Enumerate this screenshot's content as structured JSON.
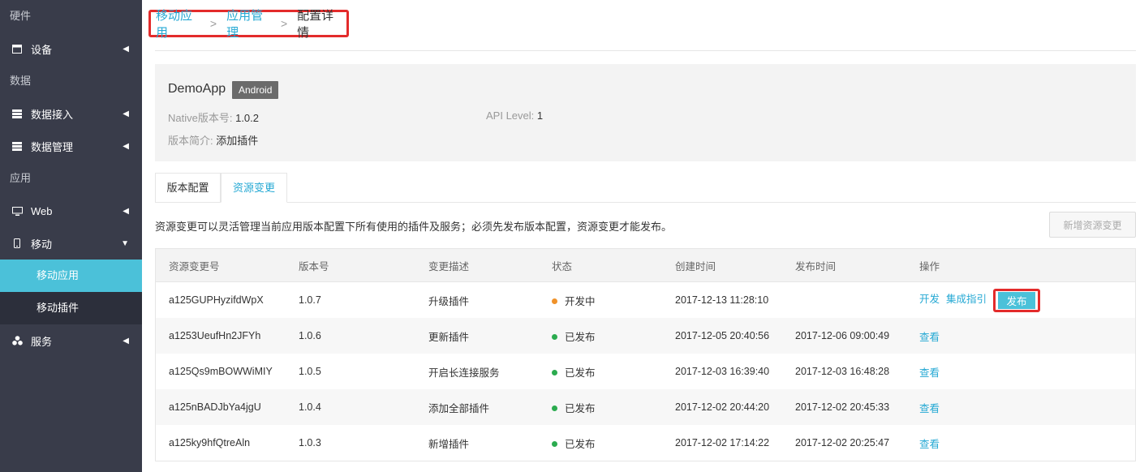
{
  "sidebar": {
    "group_hardware": "硬件",
    "item_device": "设备",
    "group_data": "数据",
    "item_data_ingest": "数据接入",
    "item_data_manage": "数据管理",
    "group_app": "应用",
    "item_web": "Web",
    "item_mobile": "移动",
    "sub_mobile_app": "移动应用",
    "sub_mobile_plugin": "移动插件",
    "item_service": "服务"
  },
  "breadcrumb": {
    "level1": "移动应用",
    "level2": "应用管理",
    "current": "配置详情",
    "separator": ">"
  },
  "app_info": {
    "name": "DemoApp",
    "platform_tag": "Android",
    "native_version_label": "Native版本号:",
    "native_version_value": "1.0.2",
    "api_level_label": "API Level:",
    "api_level_value": "1",
    "version_desc_label": "版本简介:",
    "version_desc_value": "添加插件"
  },
  "tabs": {
    "version_config": "版本配置",
    "resource_change": "资源变更",
    "active": "资源变更"
  },
  "description": "资源变更可以灵活管理当前应用版本配置下所有使用的插件及服务；必须先发布版本配置，资源变更才能发布。",
  "new_button": "新增资源变更",
  "table": {
    "headers": [
      "资源变更号",
      "版本号",
      "变更描述",
      "状态",
      "创建时间",
      "发布时间",
      "操作"
    ],
    "rows": [
      {
        "id": "a125GUPHyzifdWpX",
        "version": "1.0.7",
        "desc": "升级插件",
        "status": "开发中",
        "created": "2017-12-13 11:28:10",
        "published": "",
        "actions": [
          "开发",
          "集成指引"
        ],
        "publish_button": "发布"
      },
      {
        "id": "a1253UeufHn2JFYh",
        "version": "1.0.6",
        "desc": "更新插件",
        "status": "已发布",
        "created": "2017-12-05 20:40:56",
        "published": "2017-12-06 09:00:49",
        "actions": [
          "查看"
        ]
      },
      {
        "id": "a125Qs9mBOWWiMIY",
        "version": "1.0.5",
        "desc": "开启长连接服务",
        "status": "已发布",
        "created": "2017-12-03 16:39:40",
        "published": "2017-12-03 16:48:28",
        "actions": [
          "查看"
        ]
      },
      {
        "id": "a125nBADJbYa4jgU",
        "version": "1.0.4",
        "desc": "添加全部插件",
        "status": "已发布",
        "created": "2017-12-02 20:44:20",
        "published": "2017-12-02 20:45:33",
        "actions": [
          "查看"
        ]
      },
      {
        "id": "a125ky9hfQtreAln",
        "version": "1.0.3",
        "desc": "新增插件",
        "status": "已发布",
        "created": "2017-12-02 17:14:22",
        "published": "2017-12-02 20:25:47",
        "actions": [
          "查看"
        ]
      }
    ]
  },
  "colors": {
    "sidebar_bg": "#393c4a",
    "accent": "#4bc1d9",
    "link": "#26a9d4",
    "highlight_border": "#e32b2b",
    "status_dev": "#f0922a",
    "status_published": "#2bab4f"
  },
  "icons": {
    "device": "window-icon",
    "data_ingest": "server-icon",
    "data_manage": "server-icon",
    "web": "monitor-icon",
    "mobile": "phone-icon",
    "service": "cubes-icon",
    "collapsed": "caret-left-icon",
    "expanded": "caret-down-icon"
  }
}
